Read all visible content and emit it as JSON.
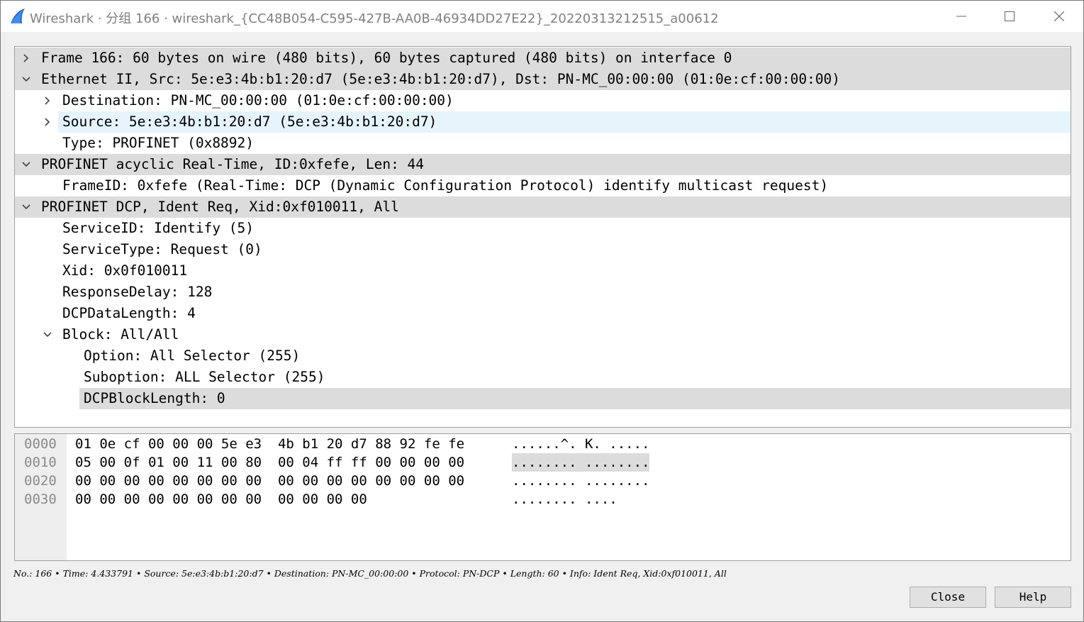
{
  "window": {
    "title": "Wireshark · 分组 166 · wireshark_{CC48B054-C595-427B-AA0B-46934DD27E22}_20220313212515_a00612",
    "icon": "wireshark-fin-icon",
    "controls": [
      "minimize-icon",
      "maximize-icon",
      "close-icon"
    ]
  },
  "tree": [
    {
      "text": "Frame 166: 60 bytes on wire (480 bits), 60 bytes captured (480 bits) on interface 0",
      "level": 0,
      "expander": "collapsed",
      "state": "highlight"
    },
    {
      "text": "Ethernet II, Src: 5e:e3:4b:b1:20:d7 (5e:e3:4b:b1:20:d7), Dst: PN-MC_00:00:00 (01:0e:cf:00:00:00)",
      "level": 0,
      "expander": "expanded",
      "state": "highlight"
    },
    {
      "text": "Destination: PN-MC_00:00:00 (01:0e:cf:00:00:00)",
      "level": 1,
      "expander": "collapsed",
      "state": "none"
    },
    {
      "text": "Source: 5e:e3:4b:b1:20:d7 (5e:e3:4b:b1:20:d7)",
      "level": 1,
      "expander": "collapsed",
      "state": "hover"
    },
    {
      "text": "Type: PROFINET (0x8892)",
      "level": 1,
      "expander": "none",
      "state": "none"
    },
    {
      "text": "PROFINET acyclic Real-Time, ID:0xfefe, Len:  44",
      "level": 0,
      "expander": "expanded",
      "state": "highlight"
    },
    {
      "text": "FrameID: 0xfefe (Real-Time: DCP (Dynamic Configuration Protocol) identify multicast request)",
      "level": 1,
      "expander": "none",
      "state": "none"
    },
    {
      "text": "PROFINET DCP, Ident Req, Xid:0xf010011, All",
      "level": 0,
      "expander": "expanded",
      "state": "highlight"
    },
    {
      "text": "ServiceID: Identify (5)",
      "level": 1,
      "expander": "none",
      "state": "none"
    },
    {
      "text": "ServiceType: Request (0)",
      "level": 1,
      "expander": "none",
      "state": "none"
    },
    {
      "text": "Xid: 0x0f010011",
      "level": 1,
      "expander": "none",
      "state": "none"
    },
    {
      "text": "ResponseDelay: 128",
      "level": 1,
      "expander": "none",
      "state": "none"
    },
    {
      "text": "DCPDataLength: 4",
      "level": 1,
      "expander": "none",
      "state": "none"
    },
    {
      "text": "Block: All/All",
      "level": 1,
      "expander": "expanded",
      "state": "none"
    },
    {
      "text": "Option: All Selector (255)",
      "level": 2,
      "expander": "none",
      "state": "none"
    },
    {
      "text": "Suboption: ALL Selector (255)",
      "level": 2,
      "expander": "none",
      "state": "none"
    },
    {
      "text": "DCPBlockLength: 0",
      "level": 2,
      "expander": "none",
      "state": "selected"
    }
  ],
  "bytes": [
    {
      "offset": "0000",
      "hex": "01 0e cf 00 00 00 5e e3  4b b1 20 d7 88 92 fe fe",
      "ascii": "......^. K. .....",
      "highlight": false
    },
    {
      "offset": "0010",
      "hex": "05 00 0f 01 00 11 00 80  00 04 ff ff 00 00 00 00",
      "ascii": "........ ........",
      "highlight": true
    },
    {
      "offset": "0020",
      "hex": "00 00 00 00 00 00 00 00  00 00 00 00 00 00 00 00",
      "ascii": "........ ........",
      "highlight": false
    },
    {
      "offset": "0030",
      "hex": "00 00 00 00 00 00 00 00  00 00 00 00",
      "ascii": "........ ....",
      "highlight": false
    }
  ],
  "status_bar": "No.: 166 • Time: 4.433791 • Source: 5e:e3:4b:b1:20:d7 • Destination: PN-MC_00:00:00 • Protocol: PN-DCP • Length: 60 • Info: Ident Req, Xid:0xf010011, All",
  "buttons": {
    "close": "Close",
    "help": "Help"
  }
}
